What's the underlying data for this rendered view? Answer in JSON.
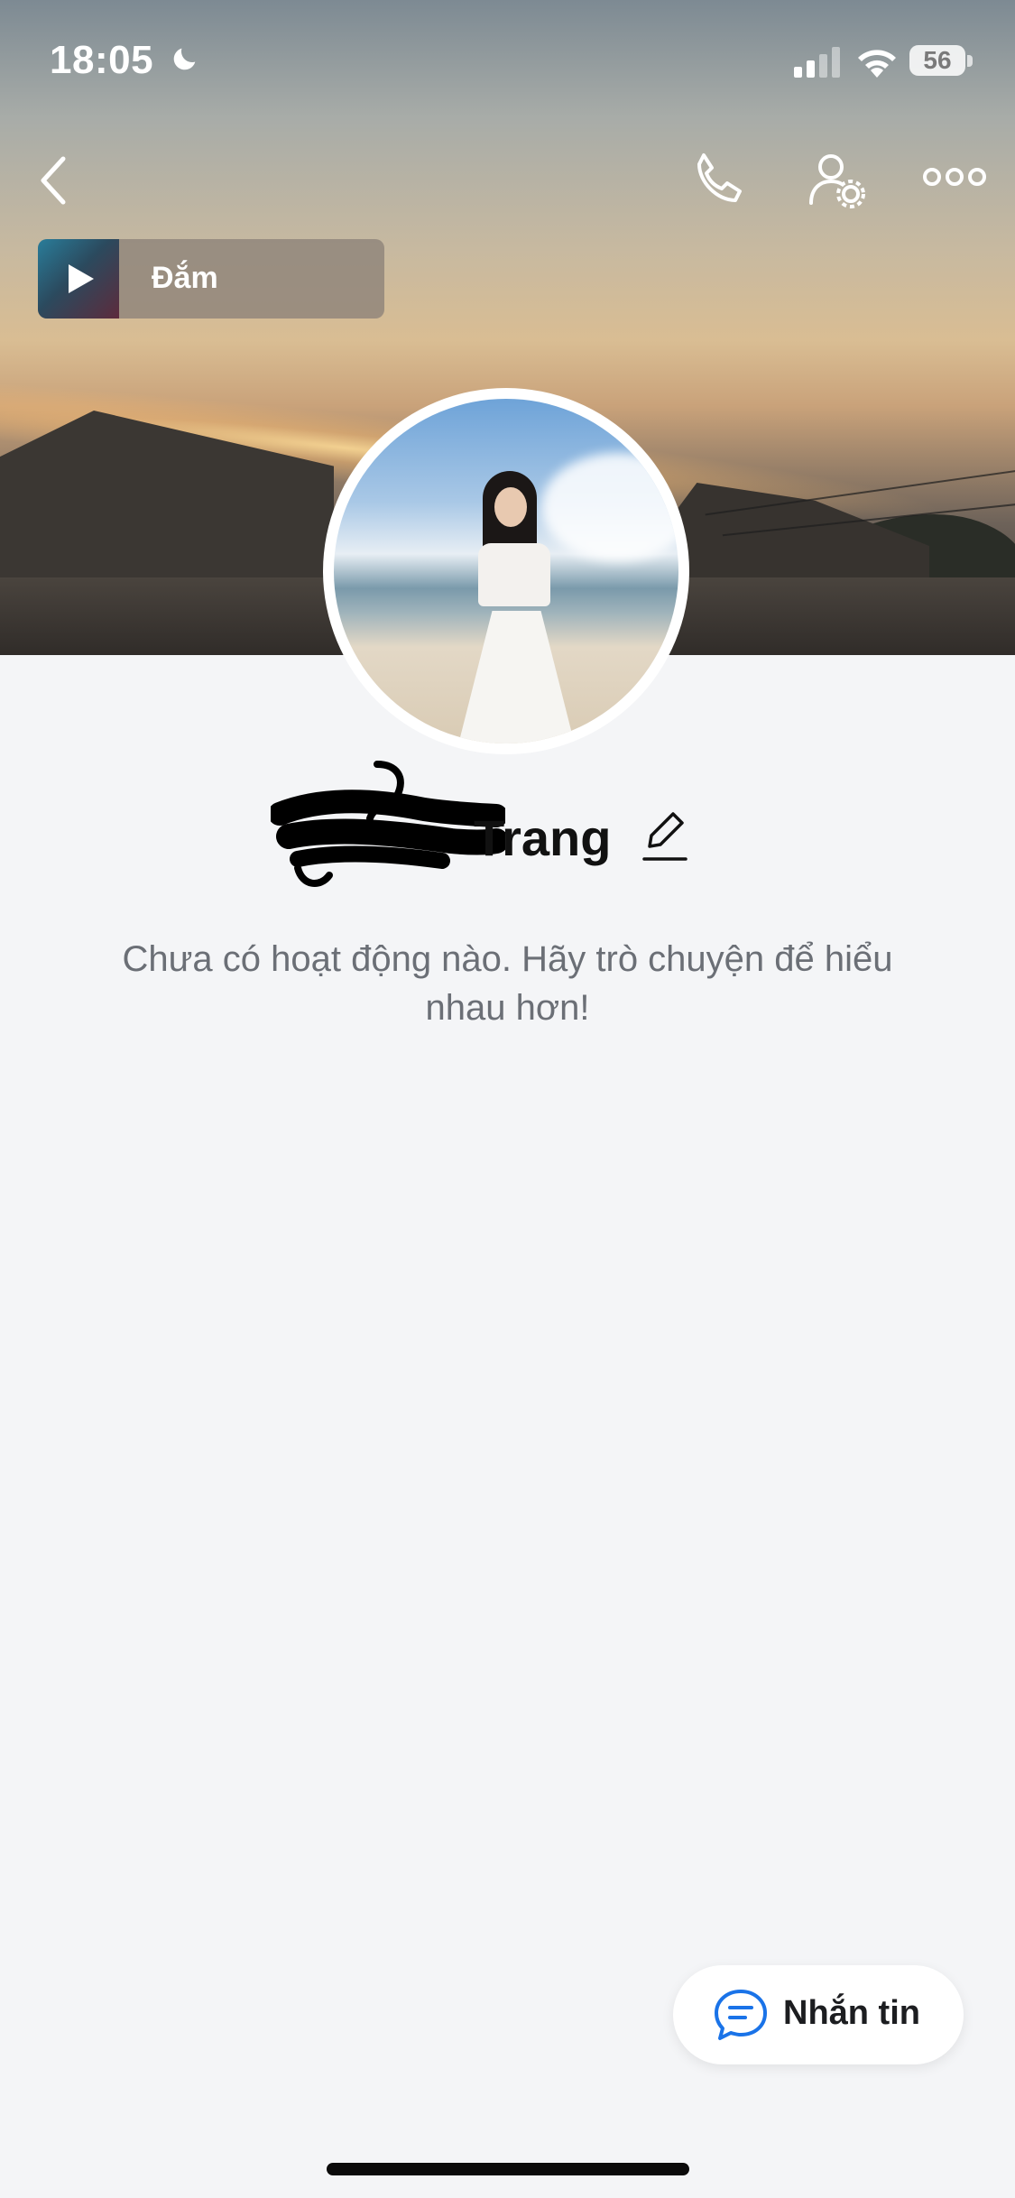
{
  "status_bar": {
    "time": "18:05",
    "battery_level": "56"
  },
  "header": {
    "back_icon": "chevron-left-icon",
    "call_icon": "phone-icon",
    "settings_icon": "user-settings-icon",
    "more_icon": "more-horizontal-icon"
  },
  "music": {
    "title": "Đắm",
    "play_icon": "play-icon"
  },
  "profile": {
    "name_visible": "Trang",
    "edit_icon": "pencil-icon",
    "empty_activity": "Chưa có hoạt động nào. Hãy trò chuyện để hiểu nhau hơn!"
  },
  "actions": {
    "message_label": "Nhắn tin",
    "message_icon": "chat-bubble-icon"
  },
  "colors": {
    "background": "#f4f5f7",
    "accent": "#1a73e8",
    "text_primary": "#111111",
    "text_secondary": "#6b6f76"
  }
}
